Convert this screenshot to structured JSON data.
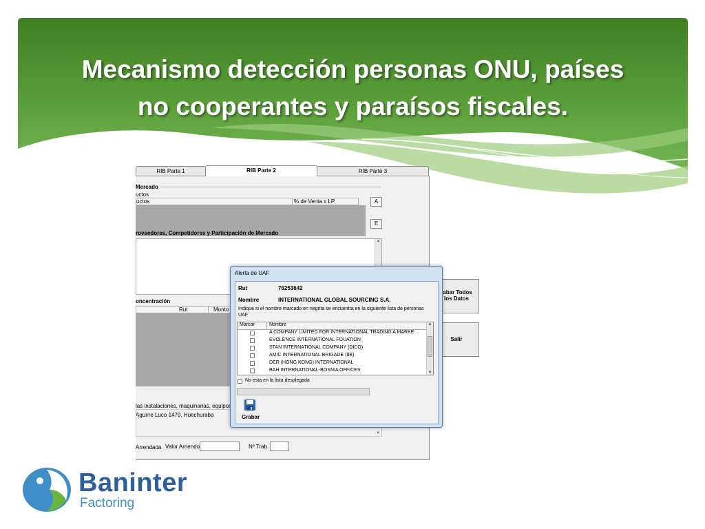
{
  "slide": {
    "title_line1": "Mecanismo detección personas ONU, países",
    "title_line2": "no cooperantes y paraísos fiscales."
  },
  "tabs": [
    {
      "label": "RIB Parte 1"
    },
    {
      "label": "RIB Parte 2",
      "active": true
    },
    {
      "label": "RIB Parte 3"
    }
  ],
  "form": {
    "section_mercado": "Mercado",
    "productos_label": "uctos",
    "grid_col_productos": "uctos",
    "grid_col_venta": "% de Venta x LP",
    "btn_a": "A",
    "btn_e": "E",
    "section_proveedores": "roveedores, Competidores y Participación de Mercado",
    "section_concentracion": "oncentración",
    "grid2_col_rut": "Rut",
    "grid2_col_monto": "Monto V",
    "label_instalaciones": "las instalaciones, maquinarias, equipos y u",
    "address": "Aguirre Luco 1479, Huechuraba",
    "label_arrendada": "Arrendada",
    "label_valor_arriendo": "Valor Arriendo",
    "label_n_trab": "Nº Trab.",
    "btn_grabar_todos_1": "rabar Todos",
    "btn_grabar_todos_2": "los Datos",
    "btn_salir": "Salir"
  },
  "dialog": {
    "title": "Alerta de UAF",
    "rut_label": "Rut",
    "rut_value": "76253642",
    "nombre_label": "Nombre",
    "nombre_value": "INTERNATIONAL GLOBAL SOURCING S.A.",
    "instruction_1": "Indique si el nombre marcado en negrita se encuentra en la siguiente lista de personas",
    "instruction_2": "UAF",
    "col_marcar": "Marcar",
    "col_nombre": "Nombre",
    "rows": [
      {
        "name": "A COMPANY LIMITED FOR INTERNATIONAL TRADING A MARKE"
      },
      {
        "name": "EVOLENCE INTERNATIONAL FOUATION"
      },
      {
        "name": "STAN INTERNATIONAL COMPANY (DICO)"
      },
      {
        "name": "AMIC INTERNATIONAL BRIGADE (IIB)"
      },
      {
        "name": "DER (HONG KONG) INTERNATIONAL"
      },
      {
        "name": "BAH INTERNATIONAL-BOSNIA OFFICES"
      }
    ],
    "no_esta_label": "No esta en la lista desplegada",
    "grabar_label": "Grabar"
  },
  "logo": {
    "brand": "Baninter",
    "sub": "Factoring"
  },
  "colors": {
    "header_green": "#5a9e3a",
    "header_green_dark": "#3f7f22",
    "logo_blue": "#2f5f9a",
    "logo_green": "#6cb33f"
  }
}
